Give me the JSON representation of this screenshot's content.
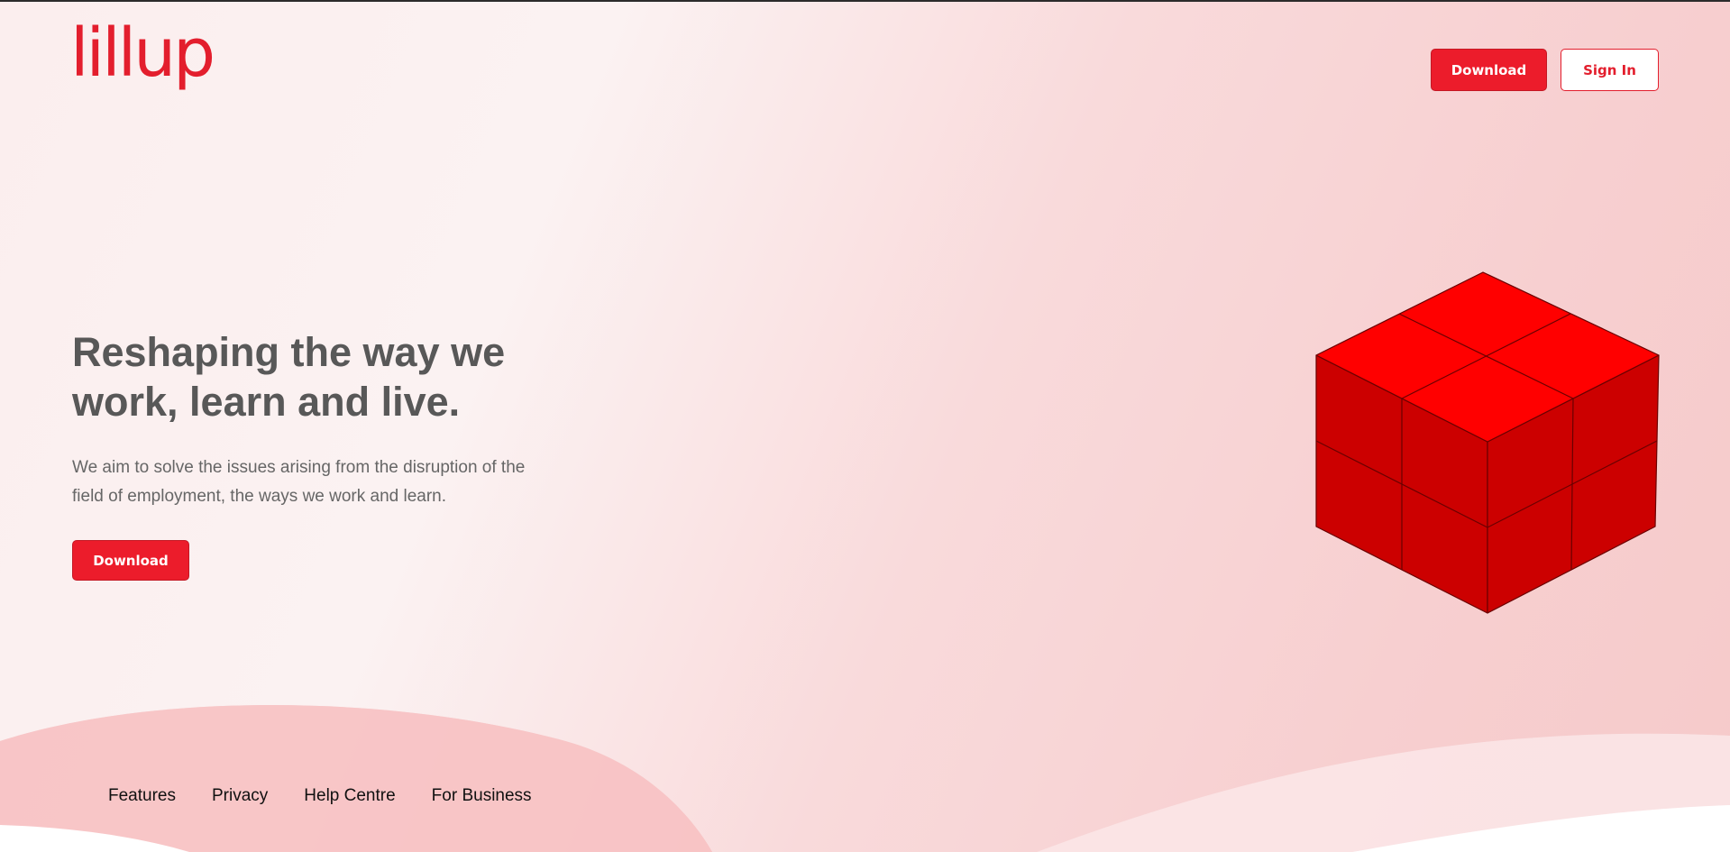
{
  "header": {
    "logo_text": "lillup",
    "download_label": "Download",
    "signin_label": "Sign In"
  },
  "hero": {
    "headline": "Reshaping the way we work, learn and live.",
    "description": "We aim to solve the issues arising from the disruption of the field of employment, the ways we work and learn.",
    "download_label": "Download"
  },
  "footer": {
    "links": [
      {
        "label": "Features"
      },
      {
        "label": "Privacy"
      },
      {
        "label": "Help Centre"
      },
      {
        "label": "For Business"
      }
    ]
  },
  "colors": {
    "brand_red": "#e31e2d",
    "button_red": "#ec1c2b",
    "cube_top": "#ff0000",
    "cube_side": "#cc0000",
    "headline_gray": "#585858"
  },
  "illustration": {
    "name": "red-cube-illustration"
  }
}
